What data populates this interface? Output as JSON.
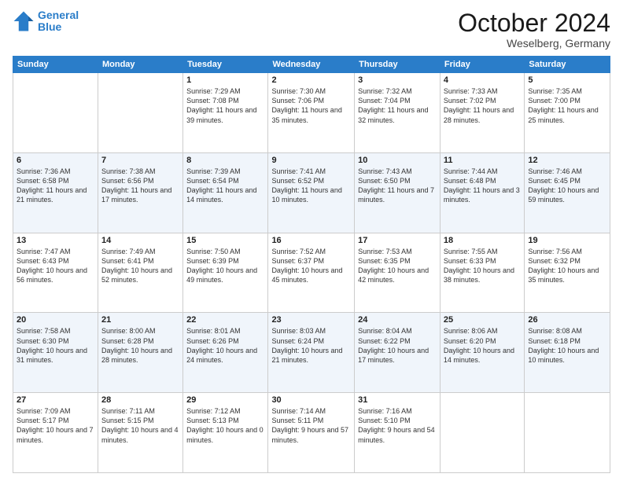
{
  "header": {
    "logo_line1": "General",
    "logo_line2": "Blue",
    "month": "October 2024",
    "location": "Weselberg, Germany"
  },
  "columns": [
    "Sunday",
    "Monday",
    "Tuesday",
    "Wednesday",
    "Thursday",
    "Friday",
    "Saturday"
  ],
  "weeks": [
    [
      {
        "day": "",
        "info": ""
      },
      {
        "day": "",
        "info": ""
      },
      {
        "day": "1",
        "info": "Sunrise: 7:29 AM\nSunset: 7:08 PM\nDaylight: 11 hours and 39 minutes."
      },
      {
        "day": "2",
        "info": "Sunrise: 7:30 AM\nSunset: 7:06 PM\nDaylight: 11 hours and 35 minutes."
      },
      {
        "day": "3",
        "info": "Sunrise: 7:32 AM\nSunset: 7:04 PM\nDaylight: 11 hours and 32 minutes."
      },
      {
        "day": "4",
        "info": "Sunrise: 7:33 AM\nSunset: 7:02 PM\nDaylight: 11 hours and 28 minutes."
      },
      {
        "day": "5",
        "info": "Sunrise: 7:35 AM\nSunset: 7:00 PM\nDaylight: 11 hours and 25 minutes."
      }
    ],
    [
      {
        "day": "6",
        "info": "Sunrise: 7:36 AM\nSunset: 6:58 PM\nDaylight: 11 hours and 21 minutes."
      },
      {
        "day": "7",
        "info": "Sunrise: 7:38 AM\nSunset: 6:56 PM\nDaylight: 11 hours and 17 minutes."
      },
      {
        "day": "8",
        "info": "Sunrise: 7:39 AM\nSunset: 6:54 PM\nDaylight: 11 hours and 14 minutes."
      },
      {
        "day": "9",
        "info": "Sunrise: 7:41 AM\nSunset: 6:52 PM\nDaylight: 11 hours and 10 minutes."
      },
      {
        "day": "10",
        "info": "Sunrise: 7:43 AM\nSunset: 6:50 PM\nDaylight: 11 hours and 7 minutes."
      },
      {
        "day": "11",
        "info": "Sunrise: 7:44 AM\nSunset: 6:48 PM\nDaylight: 11 hours and 3 minutes."
      },
      {
        "day": "12",
        "info": "Sunrise: 7:46 AM\nSunset: 6:45 PM\nDaylight: 10 hours and 59 minutes."
      }
    ],
    [
      {
        "day": "13",
        "info": "Sunrise: 7:47 AM\nSunset: 6:43 PM\nDaylight: 10 hours and 56 minutes."
      },
      {
        "day": "14",
        "info": "Sunrise: 7:49 AM\nSunset: 6:41 PM\nDaylight: 10 hours and 52 minutes."
      },
      {
        "day": "15",
        "info": "Sunrise: 7:50 AM\nSunset: 6:39 PM\nDaylight: 10 hours and 49 minutes."
      },
      {
        "day": "16",
        "info": "Sunrise: 7:52 AM\nSunset: 6:37 PM\nDaylight: 10 hours and 45 minutes."
      },
      {
        "day": "17",
        "info": "Sunrise: 7:53 AM\nSunset: 6:35 PM\nDaylight: 10 hours and 42 minutes."
      },
      {
        "day": "18",
        "info": "Sunrise: 7:55 AM\nSunset: 6:33 PM\nDaylight: 10 hours and 38 minutes."
      },
      {
        "day": "19",
        "info": "Sunrise: 7:56 AM\nSunset: 6:32 PM\nDaylight: 10 hours and 35 minutes."
      }
    ],
    [
      {
        "day": "20",
        "info": "Sunrise: 7:58 AM\nSunset: 6:30 PM\nDaylight: 10 hours and 31 minutes."
      },
      {
        "day": "21",
        "info": "Sunrise: 8:00 AM\nSunset: 6:28 PM\nDaylight: 10 hours and 28 minutes."
      },
      {
        "day": "22",
        "info": "Sunrise: 8:01 AM\nSunset: 6:26 PM\nDaylight: 10 hours and 24 minutes."
      },
      {
        "day": "23",
        "info": "Sunrise: 8:03 AM\nSunset: 6:24 PM\nDaylight: 10 hours and 21 minutes."
      },
      {
        "day": "24",
        "info": "Sunrise: 8:04 AM\nSunset: 6:22 PM\nDaylight: 10 hours and 17 minutes."
      },
      {
        "day": "25",
        "info": "Sunrise: 8:06 AM\nSunset: 6:20 PM\nDaylight: 10 hours and 14 minutes."
      },
      {
        "day": "26",
        "info": "Sunrise: 8:08 AM\nSunset: 6:18 PM\nDaylight: 10 hours and 10 minutes."
      }
    ],
    [
      {
        "day": "27",
        "info": "Sunrise: 7:09 AM\nSunset: 5:17 PM\nDaylight: 10 hours and 7 minutes."
      },
      {
        "day": "28",
        "info": "Sunrise: 7:11 AM\nSunset: 5:15 PM\nDaylight: 10 hours and 4 minutes."
      },
      {
        "day": "29",
        "info": "Sunrise: 7:12 AM\nSunset: 5:13 PM\nDaylight: 10 hours and 0 minutes."
      },
      {
        "day": "30",
        "info": "Sunrise: 7:14 AM\nSunset: 5:11 PM\nDaylight: 9 hours and 57 minutes."
      },
      {
        "day": "31",
        "info": "Sunrise: 7:16 AM\nSunset: 5:10 PM\nDaylight: 9 hours and 54 minutes."
      },
      {
        "day": "",
        "info": ""
      },
      {
        "day": "",
        "info": ""
      }
    ]
  ]
}
